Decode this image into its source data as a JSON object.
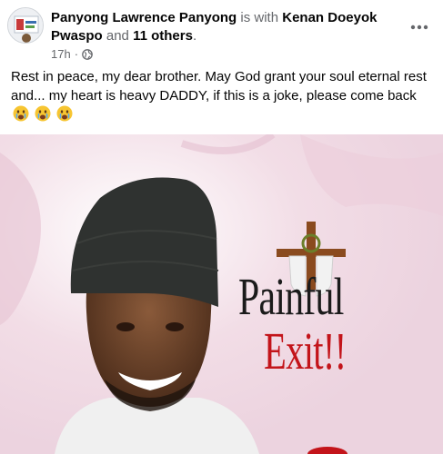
{
  "post": {
    "author": "Panyong Lawrence Panyong",
    "with_text": "is with",
    "tagged_person": "Kenan Doeyok Pwaspo",
    "and_text": "and",
    "others": "11 others",
    "end_punct": ".",
    "time": "17h",
    "separator": "·",
    "audience_icon": "globe-icon",
    "more_icon": "more-options-icon",
    "caption": "Rest in peace, my dear brother. May God grant your soul eternal rest and... my heart is heavy DADDY, if this is a joke, please come back",
    "caption_emojis": [
      "crying-face-emoji",
      "crying-face-emoji",
      "crying-face-emoji"
    ]
  },
  "poster": {
    "title_line1": "Painful",
    "title_line2": "Exit!!",
    "colors": {
      "title_dark": "#1b1b1b",
      "title_red": "#c3141a",
      "background": "#f4e6ec",
      "cross": "#8a4b1f"
    }
  }
}
